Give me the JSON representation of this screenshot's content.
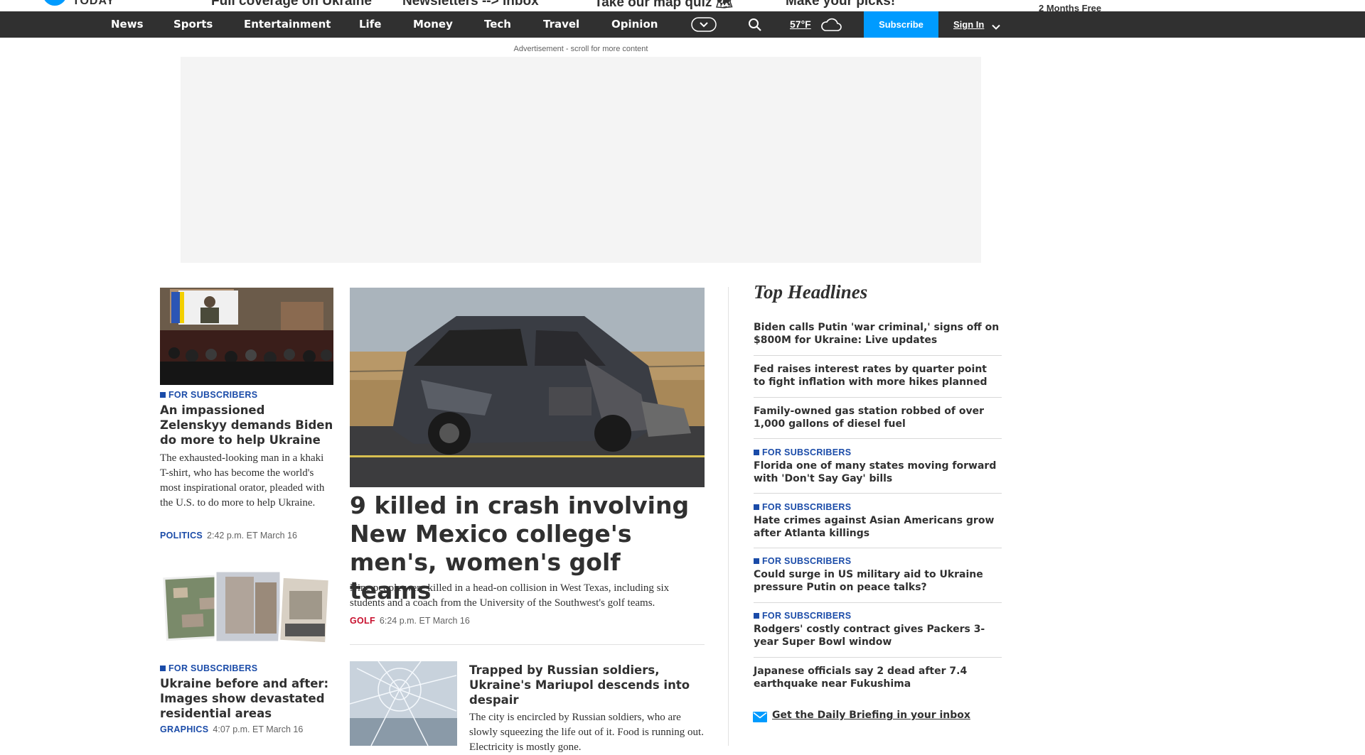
{
  "top_strip": {
    "logo": "TODAY",
    "promos": [
      "Full coverage on Ukraine",
      "Newsletters --> inbox",
      "Take our map quiz 🗺",
      "Make your picks!"
    ],
    "right_promo": "2 Months Free"
  },
  "nav": {
    "items": [
      "News",
      "Sports",
      "Entertainment",
      "Life",
      "Money",
      "Tech",
      "Travel",
      "Opinion"
    ],
    "weather_temp": "57°F",
    "subscribe": "Subscribe",
    "signin": "Sign In",
    "icons": [
      "more-chevron-icon",
      "search-icon",
      "cloud-icon",
      "chevron-down-icon"
    ]
  },
  "ad": {
    "label": "Advertisement - scroll for more content"
  },
  "left_column": [
    {
      "badge": "FOR SUBSCRIBERS",
      "headline": "An impassioned Zelenskyy demands Biden do more to help Ukraine",
      "dek": "The exhausted-looking man in a khaki T-shirt, who has become the world's most inspirational orator, pleaded with the U.S. to do more to help Ukraine.",
      "tag": "POLITICS",
      "time": "2:42 p.m. ET March 16"
    },
    {
      "badge": "FOR SUBSCRIBERS",
      "headline": "Ukraine before and after: Images show devastated residential areas",
      "tag": "GRAPHICS",
      "time": "4:07 p.m. ET March 16"
    }
  ],
  "lead_story": {
    "headline": "9 killed in crash involving New Mexico college's men's, women's golf teams",
    "dek": "Nine people were killed in a head-on collision in West Texas, including six students and a coach from the University of the Southwest's golf teams.",
    "tag": "GOLF",
    "time": "6:24 p.m. ET March 16"
  },
  "second_story": {
    "headline": "Trapped by Russian soldiers, Ukraine's Mariupol descends into despair",
    "dek": "The city is encircled by Russian soldiers, who are slowly squeezing the life out of it. Food is running out. Electricity is mostly gone."
  },
  "top_headlines": {
    "title": "Top Headlines",
    "items": [
      {
        "badge": "",
        "text": "Biden calls Putin 'war criminal,' signs off on $800M for Ukraine: Live updates"
      },
      {
        "badge": "",
        "text": "Fed raises interest rates by quarter point to fight inflation with more hikes planned"
      },
      {
        "badge": "",
        "text": "Family-owned gas station robbed of over 1,000 gallons of diesel fuel"
      },
      {
        "badge": "FOR SUBSCRIBERS",
        "text": "Florida one of many states moving forward with 'Don't Say Gay' bills"
      },
      {
        "badge": "FOR SUBSCRIBERS",
        "text": "Hate crimes against Asian Americans grow after Atlanta killings"
      },
      {
        "badge": "FOR SUBSCRIBERS",
        "text": "Could surge in US military aid to Ukraine pressure Putin on peace talks?"
      },
      {
        "badge": "FOR SUBSCRIBERS",
        "text": "Rodgers' costly contract gives Packers 3-year Super Bowl window"
      },
      {
        "badge": "",
        "text": "Japanese officials say 2 dead after 7.4 earthquake near Fukushima"
      }
    ],
    "newsletter": "Get the Daily Briefing in your inbox"
  },
  "colors": {
    "nav_bg": "#303030",
    "accent": "#009bff",
    "subscriber_blue": "#1a4ba8",
    "politics_tag": "#1a4ba8",
    "golf_tag": "#c8102e"
  }
}
